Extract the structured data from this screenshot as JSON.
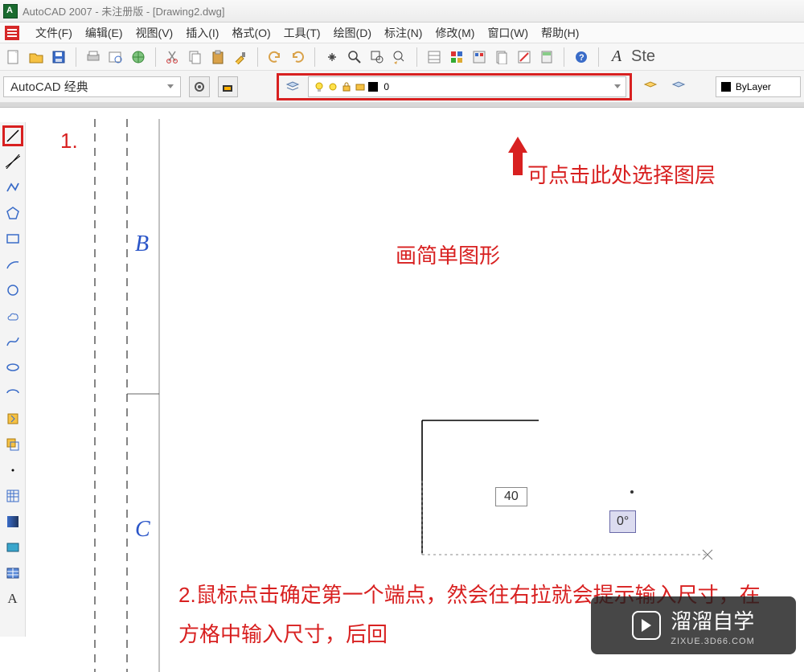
{
  "title": "AutoCAD 2007 - 未注册版 - [Drawing2.dwg]",
  "menu": {
    "file": "文件(F)",
    "edit": "编辑(E)",
    "view": "视图(V)",
    "insert": "插入(I)",
    "format": "格式(O)",
    "tools": "工具(T)",
    "draw": "绘图(D)",
    "dimension": "标注(N)",
    "modify": "修改(M)",
    "window": "窗口(W)",
    "help": "帮助(H)"
  },
  "workspace": "AutoCAD 经典",
  "layer": {
    "name": "0"
  },
  "linetype": "ByLayer",
  "letter_a": "A",
  "big_letter": "Ste",
  "axis_b": "B",
  "axis_c": "C",
  "anno1": "1.",
  "anno_title": "画简单图形",
  "anno_layer": "可点击此处选择图层",
  "anno2": "2.鼠标点击确定第一个端点，然会往右拉就会提示输入尺寸，在方格中输入尺寸，后回",
  "dim_value": "40",
  "angle_value": "0°",
  "watermark": {
    "brand": "溜溜自学",
    "site": "ZIXUE.3D66.COM"
  }
}
